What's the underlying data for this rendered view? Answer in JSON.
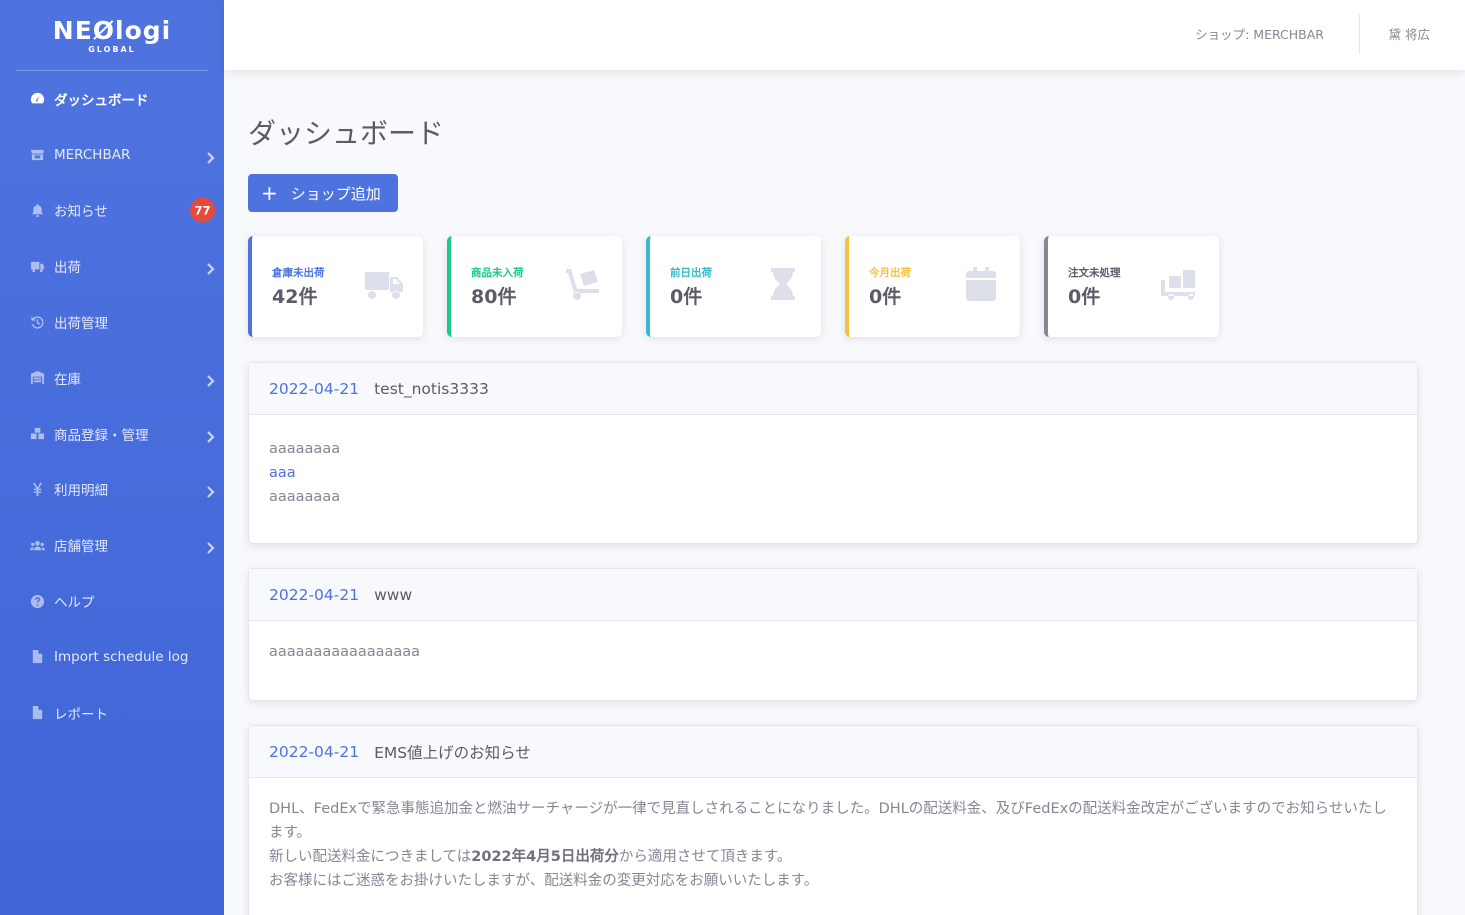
{
  "brand": {
    "name": "NEØlogi",
    "sub": "GLOBAL"
  },
  "sidebar": {
    "items": [
      {
        "label": "ダッシュボード",
        "icon": "tachometer-icon",
        "active": true
      },
      {
        "label": "MERCHBAR",
        "icon": "store-icon",
        "chevron": true
      },
      {
        "label": "お知らせ",
        "icon": "bell-icon",
        "badge": "77"
      },
      {
        "label": "出荷",
        "icon": "truck-icon",
        "chevron": true
      },
      {
        "label": "出荷管理",
        "icon": "history-icon"
      },
      {
        "label": "在庫",
        "icon": "warehouse-icon",
        "chevron": true
      },
      {
        "label": "商品登録・管理",
        "icon": "boxes-icon",
        "chevron": true
      },
      {
        "label": "利用明細",
        "icon": "yen-icon",
        "chevron": true
      },
      {
        "label": "店舗管理",
        "icon": "users-icon",
        "chevron": true
      },
      {
        "label": "ヘルプ",
        "icon": "question-icon"
      },
      {
        "label": "Import schedule log",
        "icon": "file-icon"
      },
      {
        "label": "レポート",
        "icon": "file-icon"
      }
    ]
  },
  "topbar": {
    "shop": "ショップ: MERCHBAR",
    "user": "黛 将広"
  },
  "main": {
    "title": "ダッシュボード",
    "add_button": "ショップ追加",
    "cards": [
      {
        "label": "倉庫未出荷",
        "value": "42件",
        "color": "#4e73df",
        "icon": "truck-icon"
      },
      {
        "label": "商品未入荷",
        "value": "80件",
        "color": "#1cc88a",
        "icon": "dolly-icon"
      },
      {
        "label": "前日出荷",
        "value": "0件",
        "color": "#36b9cc",
        "icon": "hourglass-icon"
      },
      {
        "label": "今月出荷",
        "value": "0件",
        "color": "#f6c23e",
        "icon": "calendar-icon"
      },
      {
        "label": "注文未処理",
        "value": "0件",
        "color": "#858796",
        "icon": "dolly-flatbed-icon"
      }
    ],
    "notices": [
      {
        "date": "2022-04-21",
        "title": "test_notis3333",
        "lines": [
          "aaaaaaaa",
          "aaa",
          "aaaaaaaa"
        ]
      },
      {
        "date": "2022-04-21",
        "title": "www",
        "lines": [
          "aaaaaaaaaaaaaaaaa"
        ]
      },
      {
        "date": "2022-04-21",
        "title": "EMS値上げのお知らせ",
        "body": {
          "line1": "DHL、FedExで緊急事態追加金と燃油サーチャージが一律で見直しされることになりました。DHLの配送料金、及びFedExの配送料金改定がございますのでお知らせいたします。",
          "line2_pre": "新しい配送料金につきましては",
          "line2_bold": "2022年4月5日出荷分",
          "line2_post": "から適用させて頂きます。",
          "line3": "お客様にはご迷惑をお掛けいたしますが、配送料金の変更対応をお願いいたします。"
        }
      }
    ]
  }
}
